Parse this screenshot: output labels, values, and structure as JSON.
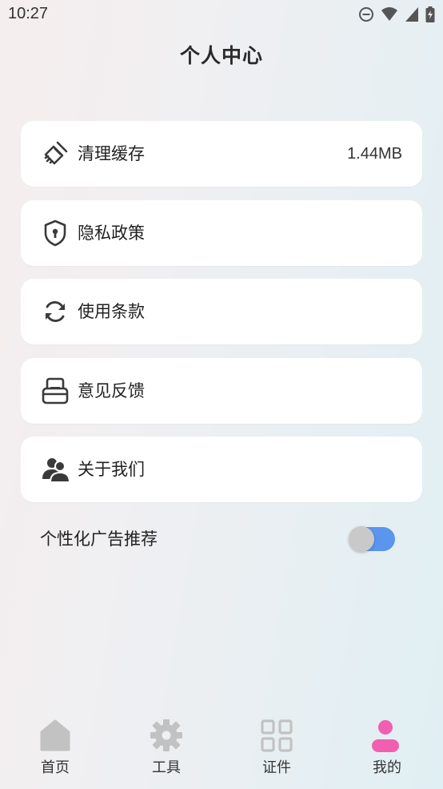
{
  "status_bar": {
    "time": "10:27",
    "icons": [
      "do-not-disturb-icon",
      "wifi-icon",
      "signal-icon",
      "battery-charging-icon"
    ]
  },
  "page": {
    "title": "个人中心"
  },
  "menu": [
    {
      "label": "清理缓存",
      "value": "1.44MB",
      "icon": "broom-icon"
    },
    {
      "label": "隐私政策",
      "icon": "shield-lock-icon"
    },
    {
      "label": "使用条款",
      "icon": "refresh-icon"
    },
    {
      "label": "意见反馈",
      "icon": "feedback-tray-icon"
    },
    {
      "label": "关于我们",
      "icon": "users-icon"
    }
  ],
  "toggle": {
    "label": "个性化广告推荐",
    "on": true
  },
  "bottom_nav": [
    {
      "label": "首页",
      "icon": "home-icon",
      "active": false
    },
    {
      "label": "工具",
      "icon": "gear-icon",
      "active": false
    },
    {
      "label": "证件",
      "icon": "grid-icon",
      "active": false
    },
    {
      "label": "我的",
      "icon": "person-icon",
      "active": true
    }
  ],
  "colors": {
    "accent_blue": "#5a95ee",
    "active_pink": "#f25fb1",
    "inactive_icon": "#c2c2c2"
  }
}
